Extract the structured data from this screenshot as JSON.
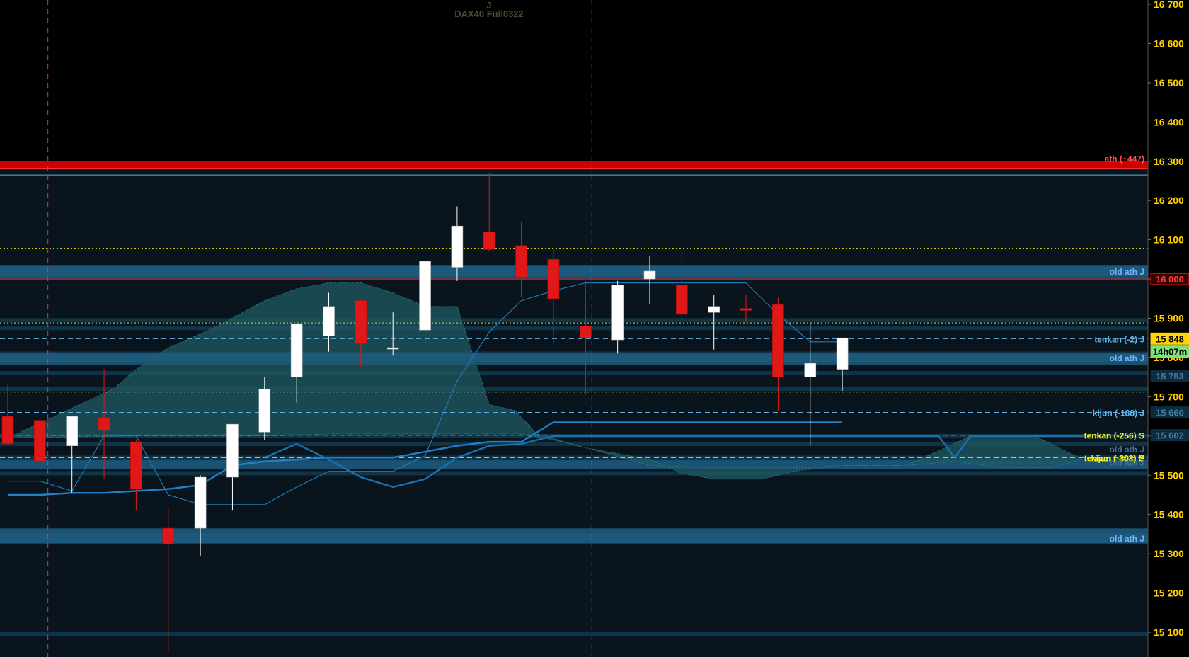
{
  "header": {
    "line1": "J",
    "line2": "DAX40 Full0322"
  },
  "colors": {
    "background": "#000000",
    "plot_bg": "#0a141c",
    "bull_candle": "#ffffff",
    "bear_candle": "#e01818",
    "cloud": "#1f5a63",
    "band": "#123e55",
    "price_axis_text": "#ffd400",
    "level_blue": "#5fb0e8",
    "level_yellow": "#e8e020",
    "ath_red": "#d00000"
  },
  "chart_data": {
    "type": "candlestick",
    "instrument": "DAX40 Full0322",
    "ylim": [
      15050,
      16700
    ],
    "y_ticks": [
      "16 700",
      "16 600",
      "16 500",
      "16 400",
      "16 300",
      "16 200",
      "16 100",
      "16 000",
      "15 900",
      "15 800",
      "15 700",
      "15 600",
      "15 500",
      "15 400",
      "15 300",
      "15 200",
      "15 100"
    ],
    "y_tick_values": [
      16700,
      16600,
      16500,
      16400,
      16300,
      16200,
      16100,
      16000,
      15900,
      15800,
      15700,
      15600,
      15500,
      15400,
      15300,
      15200,
      15100
    ],
    "candles": [
      {
        "o": 15650,
        "h": 15730,
        "l": 15580,
        "c": 15580
      },
      {
        "o": 15640,
        "h": 15640,
        "l": 15530,
        "c": 15535
      },
      {
        "o": 15575,
        "h": 15645,
        "l": 15455,
        "c": 15650
      },
      {
        "o": 15645,
        "h": 15770,
        "l": 15490,
        "c": 15615
      },
      {
        "o": 15585,
        "h": 15590,
        "l": 15410,
        "c": 15465
      },
      {
        "o": 15365,
        "h": 15415,
        "l": 15050,
        "c": 15325
      },
      {
        "o": 15365,
        "h": 15500,
        "l": 15295,
        "c": 15495
      },
      {
        "o": 15495,
        "h": 15630,
        "l": 15410,
        "c": 15630
      },
      {
        "o": 15610,
        "h": 15750,
        "l": 15590,
        "c": 15720
      },
      {
        "o": 15750,
        "h": 15885,
        "l": 15685,
        "c": 15885
      },
      {
        "o": 15855,
        "h": 15965,
        "l": 15815,
        "c": 15930
      },
      {
        "o": 15945,
        "h": 15945,
        "l": 15775,
        "c": 15835
      },
      {
        "o": 15825,
        "h": 15915,
        "l": 15805,
        "c": 15825
      },
      {
        "o": 15870,
        "h": 16045,
        "l": 15835,
        "c": 16045
      },
      {
        "o": 16030,
        "h": 16185,
        "l": 15995,
        "c": 16135
      },
      {
        "o": 16120,
        "h": 16270,
        "l": 16070,
        "c": 16075
      },
      {
        "o": 16085,
        "h": 16145,
        "l": 15955,
        "c": 16005
      },
      {
        "o": 16050,
        "h": 16080,
        "l": 15835,
        "c": 15950
      },
      {
        "o": 15880,
        "h": 15995,
        "l": 15705,
        "c": 15850
      },
      {
        "o": 15845,
        "h": 15995,
        "l": 15810,
        "c": 15985
      },
      {
        "o": 16000,
        "h": 16060,
        "l": 15935,
        "c": 16020
      },
      {
        "o": 15985,
        "h": 16075,
        "l": 15890,
        "c": 15910
      },
      {
        "o": 15915,
        "h": 15960,
        "l": 15820,
        "c": 15930
      },
      {
        "o": 15925,
        "h": 15960,
        "l": 15890,
        "c": 15920
      },
      {
        "o": 15935,
        "h": 15955,
        "l": 15665,
        "c": 15750
      },
      {
        "o": 15750,
        "h": 15885,
        "l": 15575,
        "c": 15785
      },
      {
        "o": 15770,
        "h": 15850,
        "l": 15715,
        "c": 15850
      }
    ],
    "cloud_upper": [
      [
        0,
        15595
      ],
      [
        3.3,
        15720
      ],
      [
        4,
        15770
      ],
      [
        5,
        15825
      ],
      [
        6,
        15860
      ],
      [
        7,
        15900
      ],
      [
        8,
        15945
      ],
      [
        9,
        15975
      ],
      [
        10,
        15990
      ],
      [
        11,
        15990
      ],
      [
        12,
        15965
      ],
      [
        13,
        15930
      ],
      [
        14,
        15930
      ],
      [
        15,
        15680
      ],
      [
        15.8,
        15665
      ],
      [
        16.5,
        15605
      ],
      [
        18,
        15570
      ],
      [
        20,
        15525
      ],
      [
        22,
        15520
      ],
      [
        24,
        15520
      ],
      [
        25,
        15520
      ],
      [
        26,
        15525
      ],
      [
        28,
        15525
      ],
      [
        30,
        15600
      ],
      [
        31,
        15600
      ],
      [
        32,
        15600
      ],
      [
        33.5,
        15540
      ]
    ],
    "cloud_lower": [
      [
        0,
        15595
      ],
      [
        4,
        15600
      ],
      [
        8,
        15600
      ],
      [
        10,
        15605
      ],
      [
        12,
        15605
      ],
      [
        14,
        15605
      ],
      [
        16,
        15605
      ],
      [
        17,
        15590
      ],
      [
        18,
        15570
      ],
      [
        20,
        15540
      ],
      [
        21,
        15505
      ],
      [
        22,
        15490
      ],
      [
        23.5,
        15490
      ],
      [
        24.5,
        15510
      ],
      [
        26,
        15525
      ],
      [
        28,
        15525
      ],
      [
        29.5,
        15535
      ],
      [
        31,
        15520
      ],
      [
        32.5,
        15520
      ],
      [
        33.5,
        15540
      ]
    ],
    "tenkan_thin": [
      [
        0,
        15485
      ],
      [
        1,
        15485
      ],
      [
        2,
        15460
      ],
      [
        3,
        15600
      ],
      [
        4,
        15600
      ],
      [
        5,
        15450
      ],
      [
        6,
        15425
      ],
      [
        7,
        15425
      ],
      [
        8,
        15425
      ],
      [
        9,
        15470
      ],
      [
        10,
        15510
      ],
      [
        11,
        15510
      ],
      [
        12,
        15510
      ],
      [
        13,
        15550
      ],
      [
        14,
        15740
      ],
      [
        15,
        15865
      ],
      [
        16,
        15945
      ],
      [
        17,
        15970
      ],
      [
        18,
        15990
      ],
      [
        19,
        15990
      ],
      [
        20,
        15990
      ],
      [
        21,
        15990
      ],
      [
        22,
        15990
      ],
      [
        23,
        15990
      ],
      [
        24,
        15910
      ],
      [
        25,
        15840
      ],
      [
        26,
        15840
      ]
    ],
    "kijun_thick": [
      [
        0,
        15450
      ],
      [
        1,
        15450
      ],
      [
        2,
        15455
      ],
      [
        3,
        15455
      ],
      [
        4,
        15460
      ],
      [
        5,
        15465
      ],
      [
        6,
        15475
      ],
      [
        7,
        15525
      ],
      [
        8,
        15535
      ],
      [
        9,
        15540
      ],
      [
        10,
        15545
      ],
      [
        11,
        15545
      ],
      [
        12,
        15545
      ],
      [
        13,
        15560
      ],
      [
        14,
        15575
      ],
      [
        15,
        15585
      ],
      [
        16,
        15585
      ],
      [
        17,
        15635
      ],
      [
        18,
        15635
      ],
      [
        19,
        15635
      ],
      [
        20,
        15635
      ],
      [
        21,
        15635
      ],
      [
        22,
        15635
      ],
      [
        23,
        15635
      ],
      [
        24,
        15635
      ],
      [
        25,
        15635
      ],
      [
        26,
        15635
      ]
    ],
    "chikou_thick": [
      [
        8,
        15545
      ],
      [
        9,
        15580
      ],
      [
        10,
        15540
      ],
      [
        11,
        15495
      ],
      [
        12,
        15470
      ],
      [
        13,
        15490
      ],
      [
        14,
        15545
      ],
      [
        15,
        15575
      ],
      [
        16,
        15580
      ],
      [
        17,
        15600
      ],
      [
        18,
        15600
      ],
      [
        19,
        15600
      ],
      [
        20,
        15600
      ],
      [
        21,
        15600
      ],
      [
        22,
        15600
      ],
      [
        23,
        15600
      ],
      [
        24,
        15600
      ],
      [
        25,
        15600
      ],
      [
        26,
        15600
      ],
      [
        27,
        15600
      ],
      [
        28,
        15600
      ],
      [
        29,
        15600
      ],
      [
        29.5,
        15545
      ],
      [
        30,
        15600
      ],
      [
        31,
        15600
      ],
      [
        32,
        15600
      ],
      [
        33.5,
        15600
      ]
    ],
    "bands": [
      15895,
      15875,
      15810,
      15760,
      15720,
      15600,
      15580,
      15545,
      15530,
      15520,
      15505,
      15360,
      15340,
      15095
    ],
    "thick_bands": [
      [
        16010,
        16025
      ],
      [
        15790,
        15800
      ],
      [
        15355,
        15335
      ],
      [
        15530,
        15525
      ]
    ],
    "ath": {
      "value": 16290,
      "label": "ath (+447)"
    },
    "levels": [
      {
        "value": 16265,
        "color": "blue",
        "style": "solid",
        "label": ""
      },
      {
        "value": 16077,
        "color": "yellow",
        "style": "dot",
        "label": ""
      },
      {
        "value": 16020,
        "color": "blue",
        "style": "band",
        "label": "old ath J"
      },
      {
        "value": 16000,
        "color": "red",
        "style": "solid",
        "label": ""
      },
      {
        "value": 15888,
        "color": "yellow",
        "style": "dot",
        "label": ""
      },
      {
        "value": 15848,
        "color": "blue",
        "style": "dash",
        "label": "tenkan (-2) J"
      },
      {
        "value": 15800,
        "color": "blue",
        "style": "band",
        "label": "old ath J"
      },
      {
        "value": 15712,
        "color": "yellow",
        "style": "dot",
        "label": ""
      },
      {
        "value": 15660,
        "color": "blue",
        "style": "dash",
        "label": "kijun (-188) J"
      },
      {
        "value": 15602,
        "color": "yellow",
        "style": "dash",
        "label": "tenkan (-256) S"
      },
      {
        "value": 15545,
        "color": "yellow",
        "style": "dash",
        "label": "tenkan (-303) S"
      },
      {
        "value": 15545,
        "color": "yellow",
        "style": "dash",
        "label": "kijun (-303) N"
      },
      {
        "value": 15340,
        "color": "blue",
        "style": "band",
        "label": "old ath J"
      }
    ],
    "faint_labels": [
      {
        "value": 15565,
        "label": "old ath J"
      },
      {
        "value": 15532,
        "label": "old ath J"
      }
    ],
    "price_boxes": [
      {
        "value": 15848,
        "label": "15 848",
        "bg": "#ffd400",
        "fg": "#000000"
      },
      {
        "value": 15815,
        "label": "14h07m",
        "bg": "#7fe07f",
        "fg": "#000000"
      },
      {
        "value": 16000,
        "label": "16 000",
        "bg": "#3a0000",
        "fg": "#ff3b3b"
      },
      {
        "value": 15753,
        "label": "15 753",
        "bg": "#0e2c3e",
        "fg": "#3f7ba0"
      },
      {
        "value": 15660,
        "label": "15 660",
        "bg": "#0e2c3e",
        "fg": "#3f7ba0"
      },
      {
        "value": 15602,
        "label": "15 602",
        "bg": "#0e2c3e",
        "fg": "#3f7ba0"
      }
    ],
    "vertical_markers": [
      {
        "bar": 1.25,
        "color": "#c030c0"
      },
      {
        "bar": 18.2,
        "color": "#e0b000"
      }
    ]
  }
}
